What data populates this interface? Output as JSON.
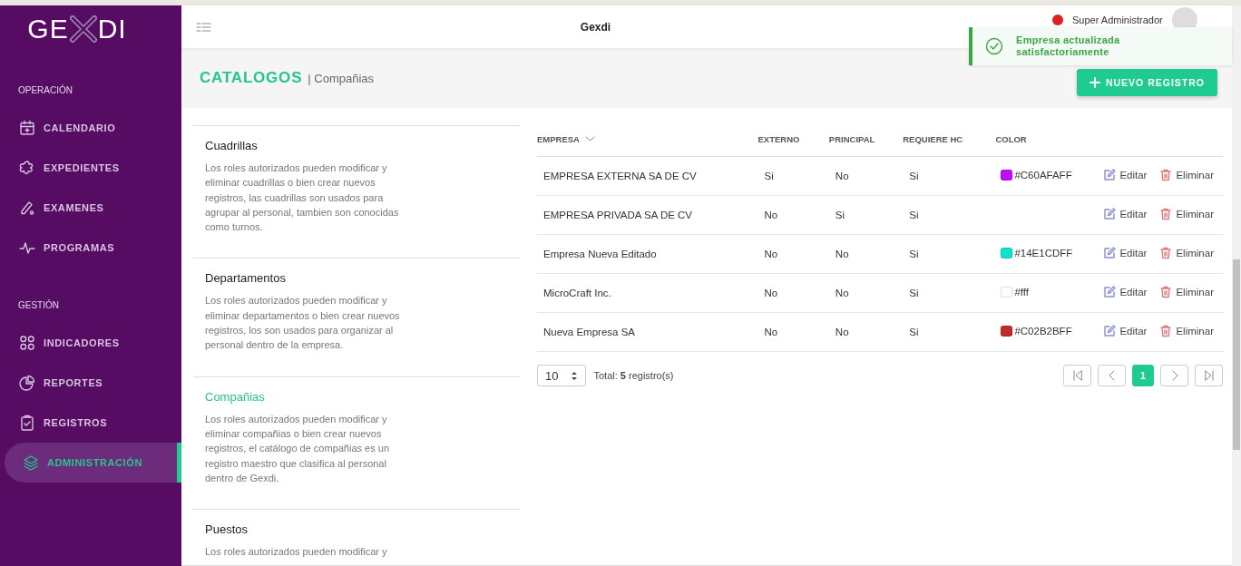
{
  "logo": {
    "left": "GE",
    "right": "DI"
  },
  "sidebar": {
    "sections": [
      {
        "title": "OPERACIÓN",
        "items": [
          {
            "label": "CALENDARIO",
            "selected": false
          },
          {
            "label": "EXPEDIENTES",
            "selected": false
          },
          {
            "label": "EXAMENES",
            "selected": false
          },
          {
            "label": "PROGRAMAS",
            "selected": false
          }
        ]
      },
      {
        "title": "GESTIÓN",
        "items": [
          {
            "label": "INDICADORES",
            "selected": false
          },
          {
            "label": "REPORTES",
            "selected": false
          },
          {
            "label": "REGISTROS",
            "selected": false
          },
          {
            "label": "ADMINISTRACIÓN",
            "selected": true
          }
        ]
      }
    ]
  },
  "header": {
    "title": "Gexdi",
    "user": "Super Administrador"
  },
  "toast": {
    "kind": "success",
    "message": "Empresa actualizada satisfactoriamente"
  },
  "page": {
    "title": "CATALOGOS",
    "subtitle": "| Compañias",
    "new_button": "NUEVO REGISTRO"
  },
  "catalogs": [
    {
      "title": "Cuadrillas",
      "description": "Los roles autorizados pueden modificar y eliminar cuadrillas o bien crear nuevos registros, las cuadrillas son usados para agrupar al personal, tambien son conocidas como turnos.",
      "selected": false
    },
    {
      "title": "Departamentos",
      "description": "Los roles autorizados pueden modificar y eliminar departamentos o bien crear nuevos registros, los son usados para organizar al personal dentro de la empresa.",
      "selected": false
    },
    {
      "title": "Compañias",
      "description": "Los roles autorizados pueden modificar y eliminar compañias o bien crear nuevos registros, el catálogo de compañias es un registro maestro que clasifica al personal dentro de Gexdi.",
      "selected": true
    },
    {
      "title": "Puestos",
      "description": "Los roles autorizados pueden modificar y",
      "selected": false
    }
  ],
  "table": {
    "columns": [
      "EMPRESA",
      "EXTERNO",
      "PRINCIPAL",
      "REQUIERE HC",
      "COLOR"
    ],
    "rows": [
      {
        "empresa": "EMPRESA EXTERNA SA DE CV",
        "externo": "Si",
        "principal": "No",
        "requiere_hc": "Si",
        "color_text": "#C60AFAFF",
        "color": "#c60afa",
        "edit": "Editar",
        "delete": "Eliminar"
      },
      {
        "empresa": "EMPRESA PRIVADA SA DE CV",
        "externo": "No",
        "principal": "Si",
        "requiere_hc": "Si",
        "edit": "Editar",
        "delete": "Eliminar"
      },
      {
        "empresa": "Empresa Nueva Editado",
        "externo": "No",
        "principal": "No",
        "requiere_hc": "Si",
        "color_text": "#14E1CDFF",
        "color": "#14e1cd",
        "edit": "Editar",
        "delete": "Eliminar"
      },
      {
        "empresa": "MicroCraft Inc.",
        "externo": "No",
        "principal": "No",
        "requiere_hc": "Si",
        "color_text": "#fff",
        "color": "#ffffff",
        "edit": "Editar",
        "delete": "Eliminar"
      },
      {
        "empresa": "Nueva Empresa SA",
        "externo": "No",
        "principal": "No",
        "requiere_hc": "Si",
        "color_text": "#C02B2BFF",
        "color": "#c02b2b",
        "edit": "Editar",
        "delete": "Eliminar"
      }
    ]
  },
  "pagination": {
    "page_size": "10",
    "total_label": "Total:",
    "total_count": "5",
    "total_unit": "registro(s)",
    "pages": [
      {
        "label": "1",
        "selected": true
      }
    ]
  }
}
